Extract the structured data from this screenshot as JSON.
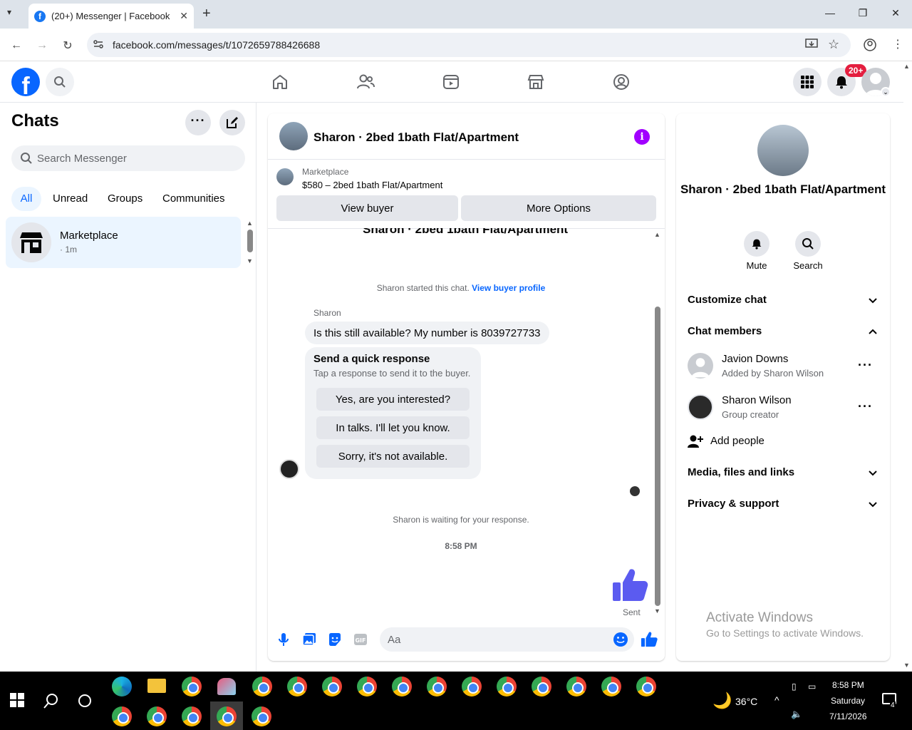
{
  "browser": {
    "tab_title": "(20+) Messenger | Facebook",
    "url": "facebook.com/messages/t/1072659788426688"
  },
  "header": {
    "notifications_badge": "20+"
  },
  "chats": {
    "title": "Chats",
    "search_placeholder": "Search Messenger",
    "filters": [
      "All",
      "Unread",
      "Groups",
      "Communities"
    ],
    "list": [
      {
        "name": "Marketplace",
        "time": "· 1m"
      }
    ]
  },
  "conversation": {
    "title": "Sharon · 2bed 1bath Flat/Apartment",
    "marketplace_label": "Marketplace",
    "listing": "$580 – 2bed 1bath Flat/Apartment",
    "view_buyer": "View buyer",
    "more_options": "More Options",
    "started_text": "Sharon started this chat.",
    "view_buyer_profile": "View buyer profile",
    "sender_name": "Sharon",
    "message": "Is this still available? My number is 8039727733",
    "quick_title": "Send a quick response",
    "quick_sub": "Tap a response to send it to the buyer.",
    "quick_responses": [
      "Yes, are you interested?",
      "In talks. I'll let you know.",
      "Sorry, it's not available."
    ],
    "waiting": "Sharon is waiting for your response.",
    "timestamp": "8:58 PM",
    "sent_label": "Sent",
    "composer_placeholder": "Aa"
  },
  "details": {
    "title": "Sharon · 2bed 1bath Flat/Apartment",
    "actions": [
      "Mute",
      "Search"
    ],
    "sections": {
      "customize": "Customize chat",
      "members": "Chat members",
      "media": "Media, files and links",
      "privacy": "Privacy & support"
    },
    "members": [
      {
        "name": "Javion Downs",
        "sub": "Added by Sharon Wilson"
      },
      {
        "name": "Sharon Wilson",
        "sub": "Group creator"
      }
    ],
    "add_people": "Add people"
  },
  "watermark": {
    "line1": "Activate Windows",
    "line2": "Go to Settings to activate Windows."
  },
  "taskbar": {
    "temperature": "36°C",
    "time": "8:58 PM",
    "day": "Saturday",
    "date": "7/11/2026",
    "notification_count": "4"
  },
  "colors": {
    "brand": "#0866ff",
    "accent_purple": "#a100ff",
    "thumb": "#5b5bf0"
  }
}
